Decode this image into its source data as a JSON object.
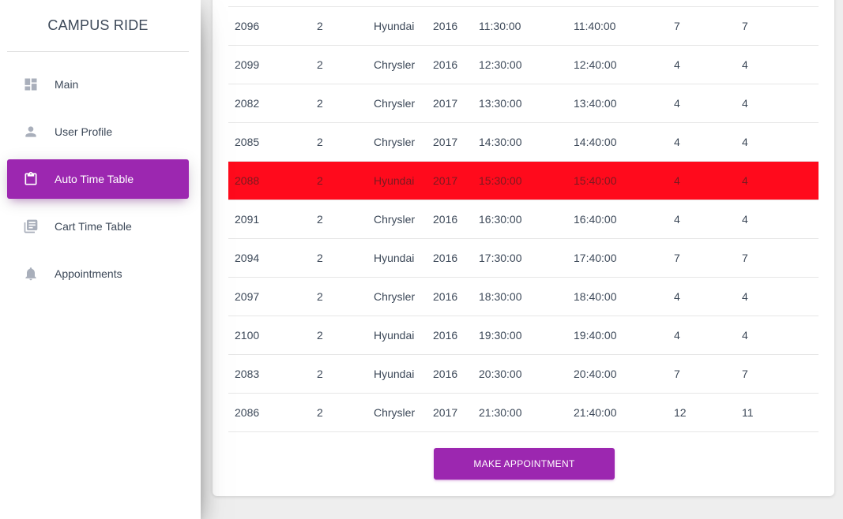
{
  "sidebar": {
    "brand": "CAMPUS RIDE",
    "items": [
      {
        "label": "Main",
        "icon": "dashboard-icon",
        "active": false
      },
      {
        "label": "User Profile",
        "icon": "person-icon",
        "active": false
      },
      {
        "label": "Auto Time Table",
        "icon": "clipboard-icon",
        "active": true
      },
      {
        "label": "Cart Time Table",
        "icon": "library-books-icon",
        "active": false
      },
      {
        "label": "Appointments",
        "icon": "bell-icon",
        "active": false
      }
    ]
  },
  "colors": {
    "accent": "#9c27b0",
    "highlight_row": "#ff0a1c",
    "background": "#eeeeee"
  },
  "table": {
    "highlighted_row_index": 4,
    "rows": [
      [
        "2096",
        "2",
        "Hyundai",
        "2016",
        "11:30:00",
        "11:40:00",
        "7",
        "7"
      ],
      [
        "2099",
        "2",
        "Chrysler",
        "2016",
        "12:30:00",
        "12:40:00",
        "4",
        "4"
      ],
      [
        "2082",
        "2",
        "Chrysler",
        "2017",
        "13:30:00",
        "13:40:00",
        "4",
        "4"
      ],
      [
        "2085",
        "2",
        "Chrysler",
        "2017",
        "14:30:00",
        "14:40:00",
        "4",
        "4"
      ],
      [
        "2088",
        "2",
        "Hyundai",
        "2017",
        "15:30:00",
        "15:40:00",
        "4",
        "4"
      ],
      [
        "2091",
        "2",
        "Chrysler",
        "2016",
        "16:30:00",
        "16:40:00",
        "4",
        "4"
      ],
      [
        "2094",
        "2",
        "Hyundai",
        "2016",
        "17:30:00",
        "17:40:00",
        "7",
        "7"
      ],
      [
        "2097",
        "2",
        "Chrysler",
        "2016",
        "18:30:00",
        "18:40:00",
        "4",
        "4"
      ],
      [
        "2100",
        "2",
        "Hyundai",
        "2016",
        "19:30:00",
        "19:40:00",
        "4",
        "4"
      ],
      [
        "2083",
        "2",
        "Hyundai",
        "2016",
        "20:30:00",
        "20:40:00",
        "7",
        "7"
      ],
      [
        "2086",
        "2",
        "Chrysler",
        "2017",
        "21:30:00",
        "21:40:00",
        "12",
        "11"
      ]
    ]
  },
  "actions": {
    "make_appointment_label": "MAKE APPOINTMENT"
  }
}
